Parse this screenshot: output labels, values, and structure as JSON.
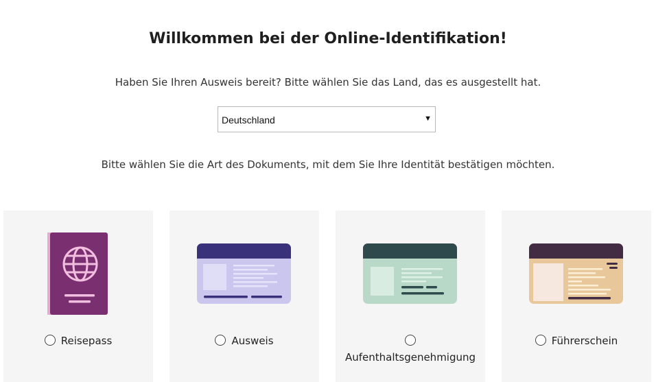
{
  "header": {
    "title": "Willkommen bei der Online-Identifikation!",
    "subtitle": "Haben Sie Ihren Ausweis bereit? Bitte wählen Sie das Land, das es ausgestellt hat."
  },
  "country_select": {
    "value": "Deutschland"
  },
  "document_prompt": "Bitte wählen Sie die Art des Dokuments, mit dem Sie Ihre Identität bestätigen möchten.",
  "documents": [
    {
      "label": "Reisepass",
      "icon": "passport-icon",
      "color": "#7a3070",
      "selected": false
    },
    {
      "label": "Ausweis",
      "icon": "id-card-icon",
      "color": "#39317a",
      "selected": false
    },
    {
      "label": "Aufenthaltsgenehmigung",
      "icon": "residence-permit-icon",
      "color": "#2e4a4c",
      "selected": false
    },
    {
      "label": "Führerschein",
      "icon": "drivers-license-icon",
      "color": "#412c44",
      "selected": false
    }
  ]
}
